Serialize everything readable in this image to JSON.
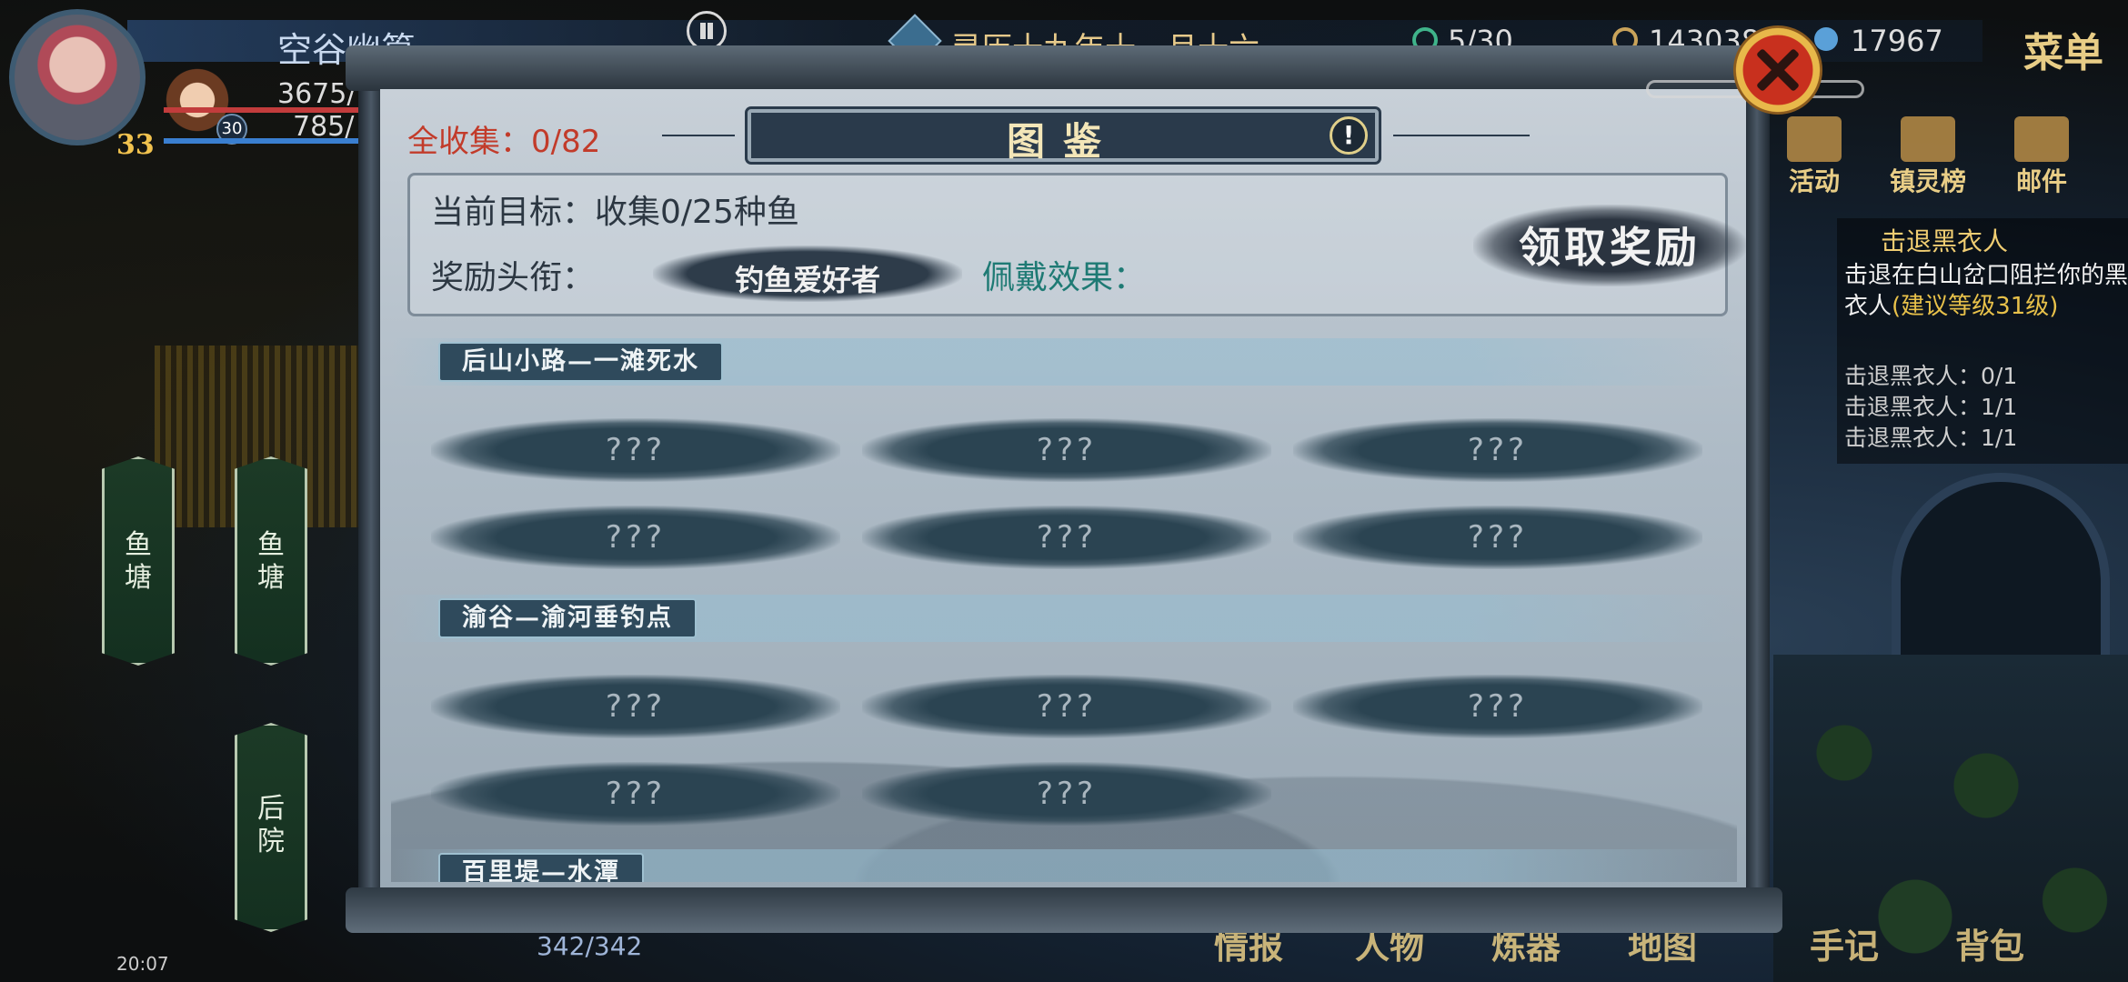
{
  "hud": {
    "player_name": "空谷幽篁",
    "player_level": "33",
    "pet_level": "30",
    "hp": "3675/",
    "mp": "785/",
    "date": "灵历十九年十一月十六",
    "stamina": "5/30",
    "coins": "143038",
    "gems": "17967",
    "menu_label": "菜单"
  },
  "side_menu": [
    {
      "label": "活动",
      "icon": "gift-icon"
    },
    {
      "label": "镇灵榜",
      "icon": "pagoda-icon"
    },
    {
      "label": "邮件",
      "icon": "scroll-icon"
    }
  ],
  "quest": {
    "title": "击退黑衣人",
    "desc": "击退在白山岔口阻拦你的黑衣人",
    "hint": "(建议等级31级",
    "hint_end": ")",
    "lines": [
      "击退黑衣人：0/1",
      "击退黑衣人：1/1",
      "击退黑衣人：1/1"
    ]
  },
  "map_nodes": [
    "鱼塘",
    "鱼塘",
    "后院"
  ],
  "bottom": {
    "stat": "342/342",
    "time": "20:07",
    "nav": [
      "情报",
      "人物",
      "炼器",
      "地图",
      "手记",
      "背包"
    ]
  },
  "modal": {
    "collect_total": "全收集：0/82",
    "title": "图鉴",
    "info_label": "!",
    "target": "当前目标：收集0/25种鱼",
    "reward_label": "奖励头衔：",
    "reward_title": "钓鱼爱好者",
    "effect_label": "佩戴效果：",
    "claim_label": "领取奖励",
    "sections": [
      {
        "name": "后山小路—一滩死水",
        "slots": [
          "???",
          "???",
          "???",
          "???",
          "???",
          "???"
        ]
      },
      {
        "name": "渝谷—渝河垂钓点",
        "slots": [
          "???",
          "???",
          "???",
          "???",
          "???"
        ]
      },
      {
        "name": "百里堤—水潭",
        "slots": []
      }
    ]
  },
  "colors": {
    "accent_gold": "#e8cd86",
    "collect_red": "#c23b2a",
    "effect_teal": "#1e7a74"
  }
}
